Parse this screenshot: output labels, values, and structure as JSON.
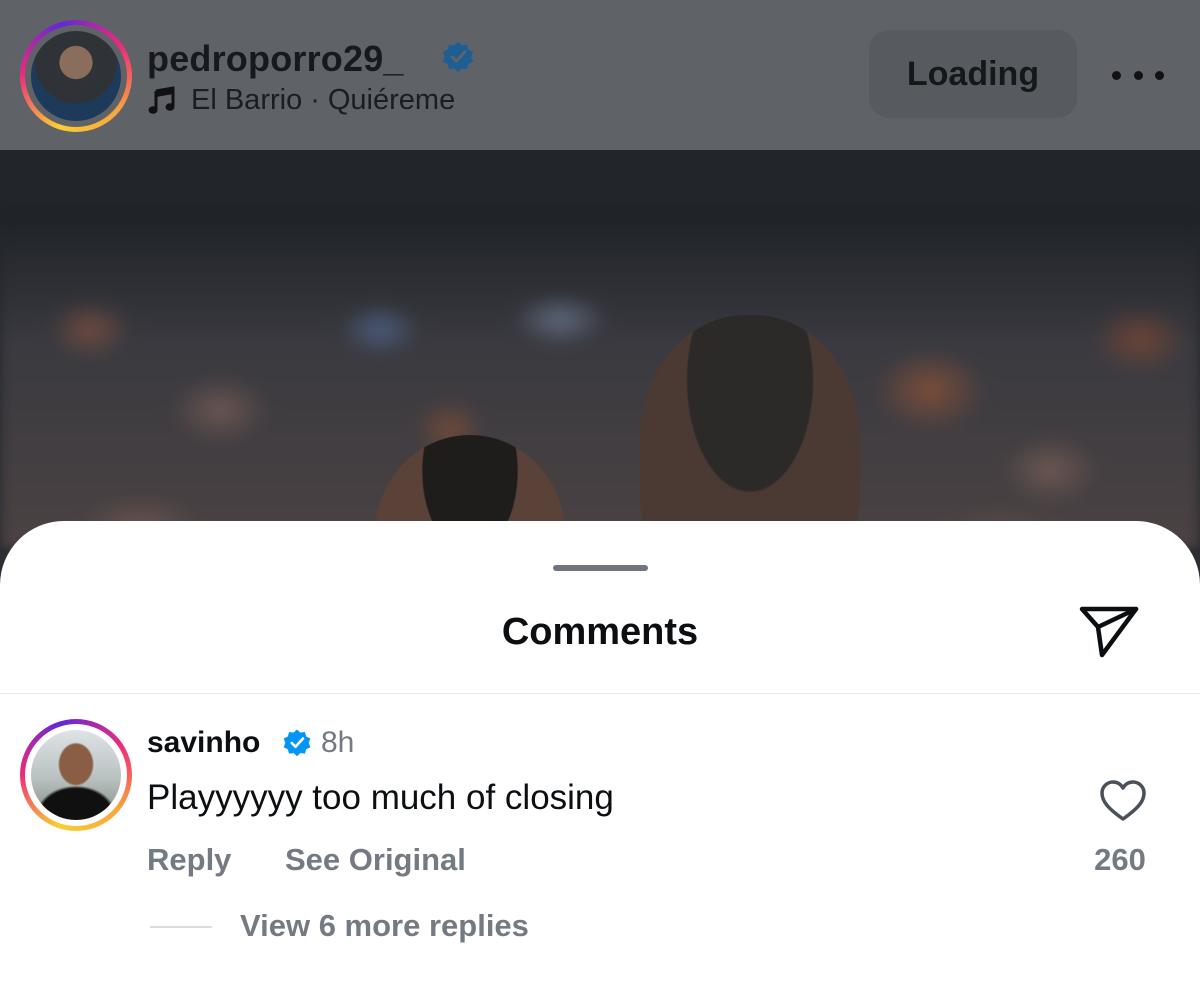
{
  "post_header": {
    "username": "pedroporro29_",
    "verified": true,
    "music": {
      "artist": "El Barrio",
      "separator": "·",
      "song": "Quiéreme"
    },
    "loading_label": "Loading"
  },
  "comments_sheet": {
    "title": "Comments",
    "comment": {
      "username": "savinho",
      "verified": true,
      "time": "8h",
      "text": "Playyyyyy too much of closing",
      "reply_label": "Reply",
      "see_original_label": "See Original",
      "like_count": "260",
      "view_replies_label": "View 6 more replies"
    }
  },
  "icons": {
    "verified": "verified-badge-icon",
    "music": "music-note-icon",
    "more": "more-options-icon",
    "share": "paper-plane-icon",
    "like": "heart-icon"
  },
  "colors": {
    "verified_blue": "#0095f6",
    "secondary_text": "#737a81",
    "primary_text": "#0c0f12",
    "dim_header": "#5f6368"
  }
}
